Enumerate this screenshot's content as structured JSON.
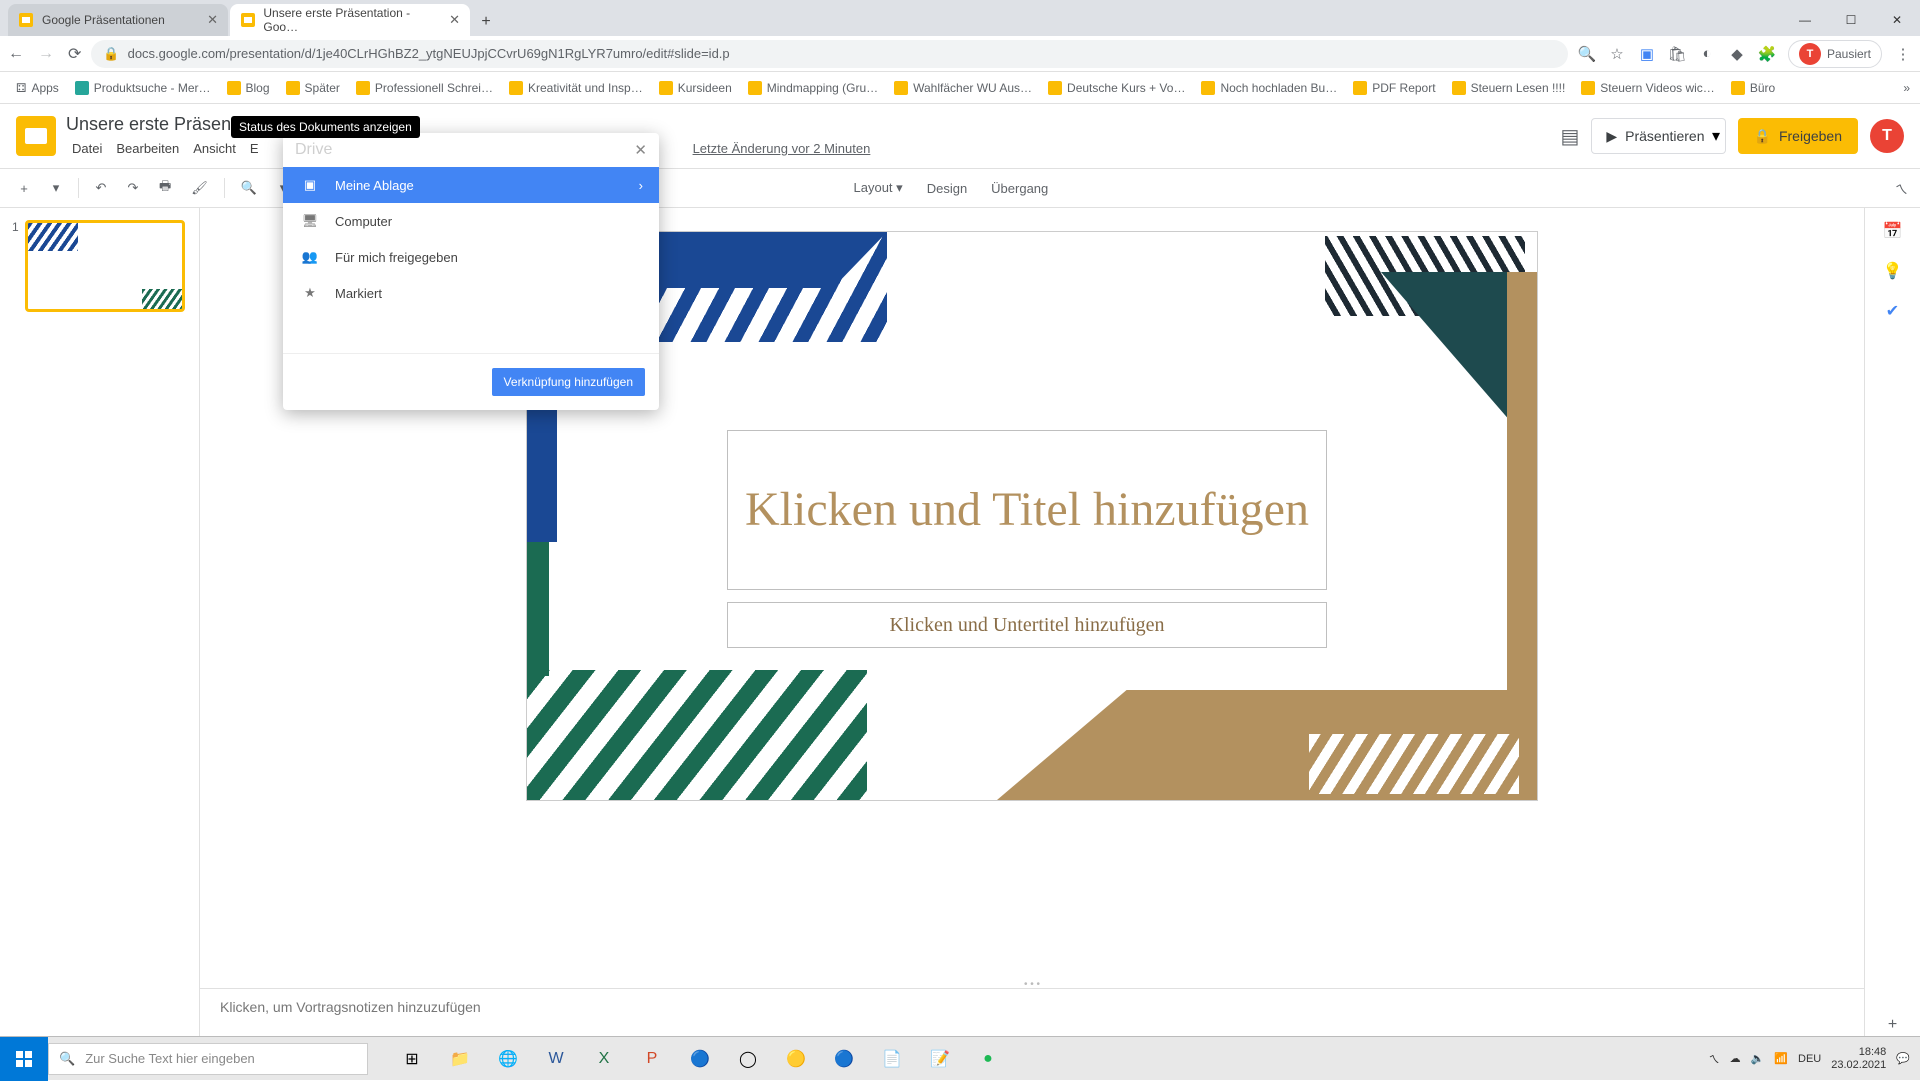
{
  "browser": {
    "tabs": [
      {
        "title": "Google Präsentationen",
        "active": false
      },
      {
        "title": "Unsere erste Präsentation - Goo…",
        "active": true
      }
    ],
    "url": "docs.google.com/presentation/d/1je40CLrHGhBZ2_ytgNEUJpjCCvrU69gN1RgLYR7umro/edit#slide=id.p",
    "pause_label": "Pausiert",
    "bookmarks_label": "Apps",
    "bookmarks": [
      "Produktsuche - Mer…",
      "Blog",
      "Später",
      "Professionell Schrei…",
      "Kreativität und Insp…",
      "Kursideen",
      "Mindmapping  (Gru…",
      "Wahlfächer WU Aus…",
      "Deutsche Kurs + Vo…",
      "Noch hochladen Bu…",
      "PDF Report",
      "Steuern Lesen !!!!",
      "Steuern Videos wic…",
      "Büro"
    ]
  },
  "header": {
    "doc_title": "Unsere erste Präsentation",
    "menus": [
      "Datei",
      "Bearbeiten",
      "Ansicht",
      "E"
    ],
    "last_edit": "Letzte Änderung vor 2 Minuten",
    "comments_tooltip": "Kommentare",
    "present_label": "Präsentieren",
    "share_label": "Freigeben",
    "avatar_letter": "T"
  },
  "tooltip": "Status des Dokuments anzeigen",
  "toolbar": {
    "layout": "Layout",
    "design": "Design",
    "transition": "Übergang"
  },
  "popover": {
    "header": "Drive",
    "items": [
      {
        "label": "Meine Ablage",
        "selected": true,
        "has_children": true
      },
      {
        "label": "Computer",
        "selected": false
      },
      {
        "label": "Für mich freigegeben",
        "selected": false
      },
      {
        "label": "Markiert",
        "selected": false
      }
    ],
    "button": "Verknüpfung hinzufügen"
  },
  "slide": {
    "number": "1",
    "title_placeholder": "Klicken und Titel hinzufügen",
    "subtitle_placeholder": "Klicken und Untertitel hinzufügen",
    "notes_placeholder": "Klicken, um Vortragsnotizen hinzuzufügen"
  },
  "taskbar": {
    "search_placeholder": "Zur Suche Text hier eingeben",
    "lang": "DEU",
    "time": "18:48",
    "date": "23.02.2021"
  },
  "colors": {
    "accent_blue": "#4285f4",
    "accent_yellow": "#fbbc04",
    "slide_tan": "#b3915f",
    "slide_green": "#1b6b52",
    "slide_blue": "#1a4894"
  }
}
